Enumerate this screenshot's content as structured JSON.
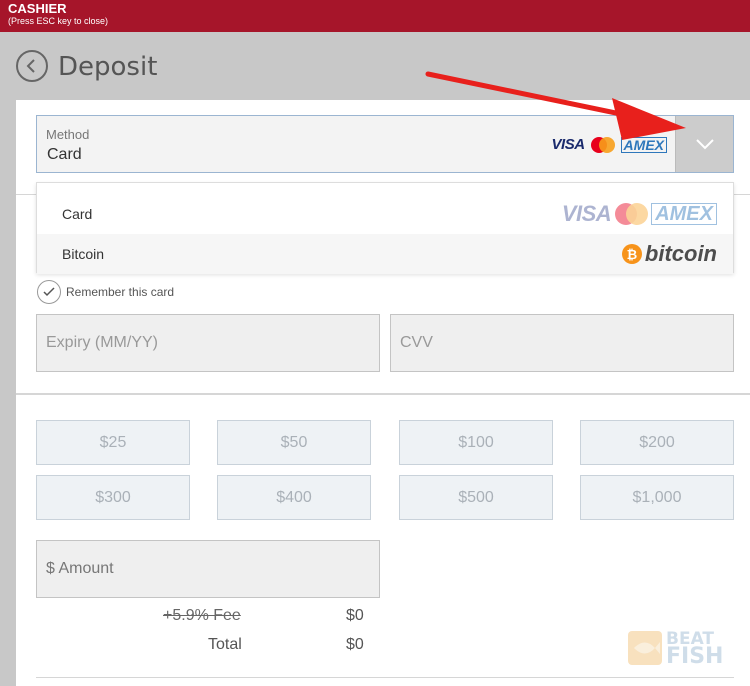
{
  "topbar": {
    "title": "CASHIER",
    "subtitle": "(Press ESC key to close)"
  },
  "header": {
    "title": "Deposit"
  },
  "method": {
    "label": "Method",
    "value": "Card",
    "logos": [
      "VISA",
      "mastercard",
      "AMEX"
    ]
  },
  "dropdown": {
    "items": [
      {
        "label": "Card",
        "logo_text": [
          "VISA",
          "AMEX"
        ]
      },
      {
        "label": "Bitcoin",
        "logo_text": "bitcoin"
      }
    ]
  },
  "remember": {
    "label": "Remember this card"
  },
  "fields": {
    "expiry_placeholder": "Expiry (MM/YY)",
    "cvv_placeholder": "CVV",
    "amount_placeholder": "$ Amount"
  },
  "amounts": [
    "$25",
    "$50",
    "$100",
    "$200",
    "$300",
    "$400",
    "$500",
    "$1,000"
  ],
  "summary": {
    "fee_label": "+5.9% Fee",
    "fee_value": "$0",
    "total_label": "Total",
    "total_value": "$0"
  },
  "watermark": {
    "line1": "BEAT",
    "line2": "FISH"
  },
  "colors": {
    "topbar": "#a6152a",
    "annotation_arrow": "#e8201c"
  }
}
